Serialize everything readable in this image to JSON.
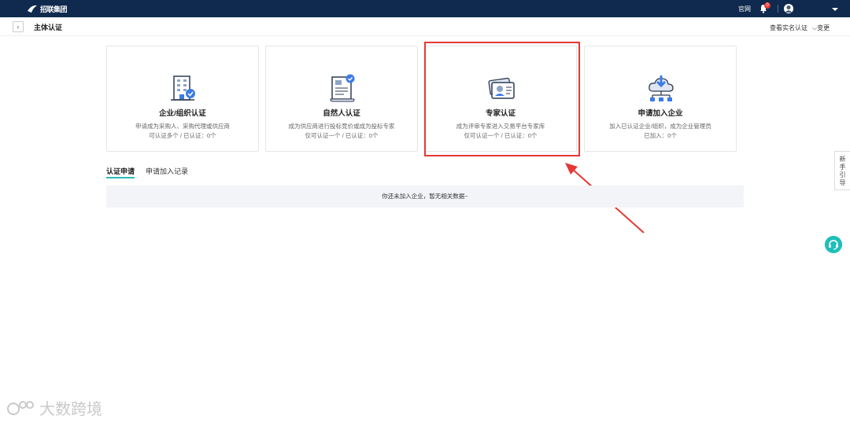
{
  "header": {
    "logo_text": "招联集团",
    "guanwang": "官网",
    "badge_count": "0"
  },
  "subbar": {
    "back_icon": "‹",
    "title": "主体认证",
    "view_cert": "查看实名认证",
    "change": "变更"
  },
  "cards": [
    {
      "title": "企业/组织认证",
      "desc1": "申请成为采购人、采购代理或供应商",
      "desc2": "可认证多个 / 已认证：0个",
      "icon": "building-check-icon"
    },
    {
      "title": "自然人认证",
      "desc1": "成为供应商进行投标竞价或成为投标专家",
      "desc2": "仅可认证一个 / 已认证：0个",
      "icon": "scroll-check-icon"
    },
    {
      "title": "专家认证",
      "desc1": "成为评审专家进入交易平台专家库",
      "desc2": "仅可认证一个 / 已认证：0个",
      "icon": "id-card-icon"
    },
    {
      "title": "申请加入企业",
      "desc1": "加入已认证企业/组织，成为企业管理员",
      "desc2": "已加入：0个",
      "icon": "cloud-network-icon"
    }
  ],
  "tabs": [
    {
      "label": "认证申请",
      "active": true
    },
    {
      "label": "申请加入记录",
      "active": false
    }
  ],
  "empty_text": "你还未加入企业，暂无相关数据~",
  "guide_label": [
    "新",
    "手",
    "引",
    "导"
  ],
  "watermark": "大数跨境",
  "colors": {
    "topbar": "#0f2a4e",
    "accent": "#2bbcb3",
    "highlight": "#e53935",
    "icon_blue": "#3c7be6"
  }
}
